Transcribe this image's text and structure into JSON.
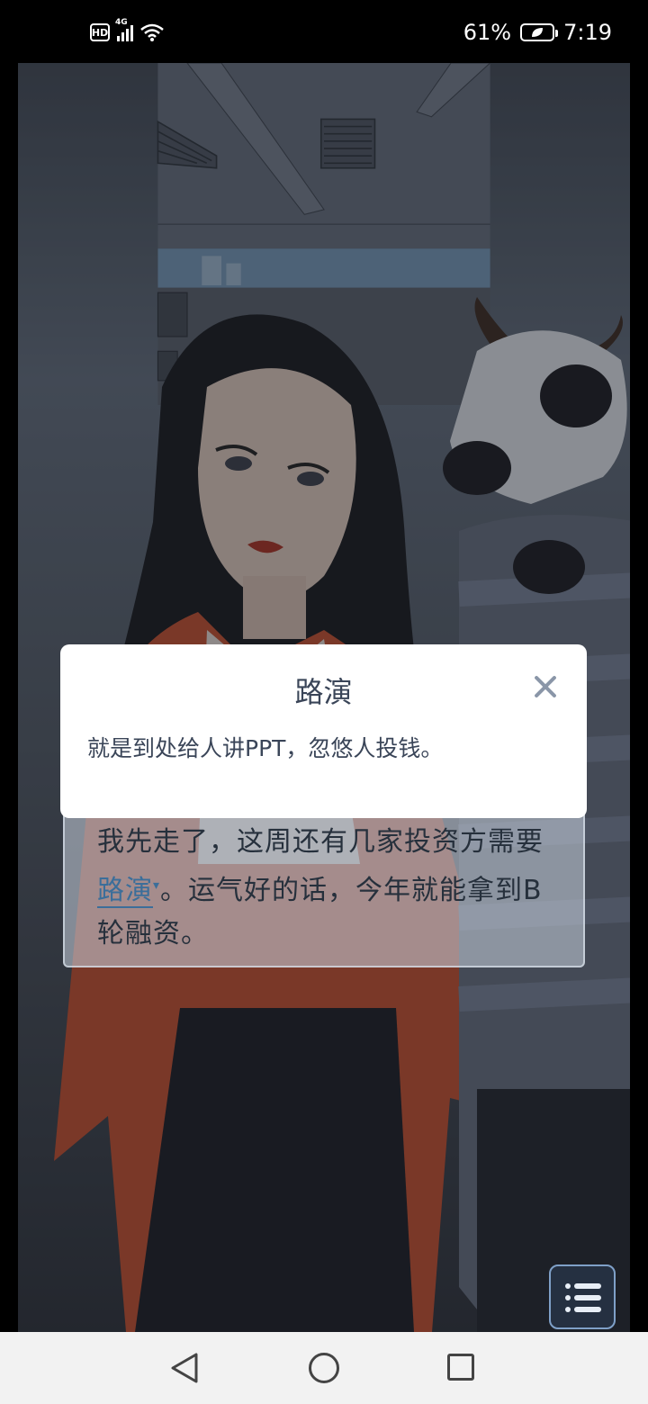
{
  "status_bar": {
    "hd": "HD",
    "network": "4G",
    "battery": "61%",
    "time": "7:19"
  },
  "dialog": {
    "line1": "我先走了，这周还有几家投资方需要",
    "term": "路演",
    "line2_rest": "。运气好的话，今年就能拿到B",
    "line3": "轮融资。"
  },
  "popup": {
    "title": "路演",
    "body": "就是到处给人讲PPT，忽悠人投钱。"
  },
  "icons": {
    "close": "close-icon",
    "menu": "menu-list-icon",
    "back": "back-icon",
    "home": "home-icon",
    "recent": "recent-apps-icon"
  }
}
